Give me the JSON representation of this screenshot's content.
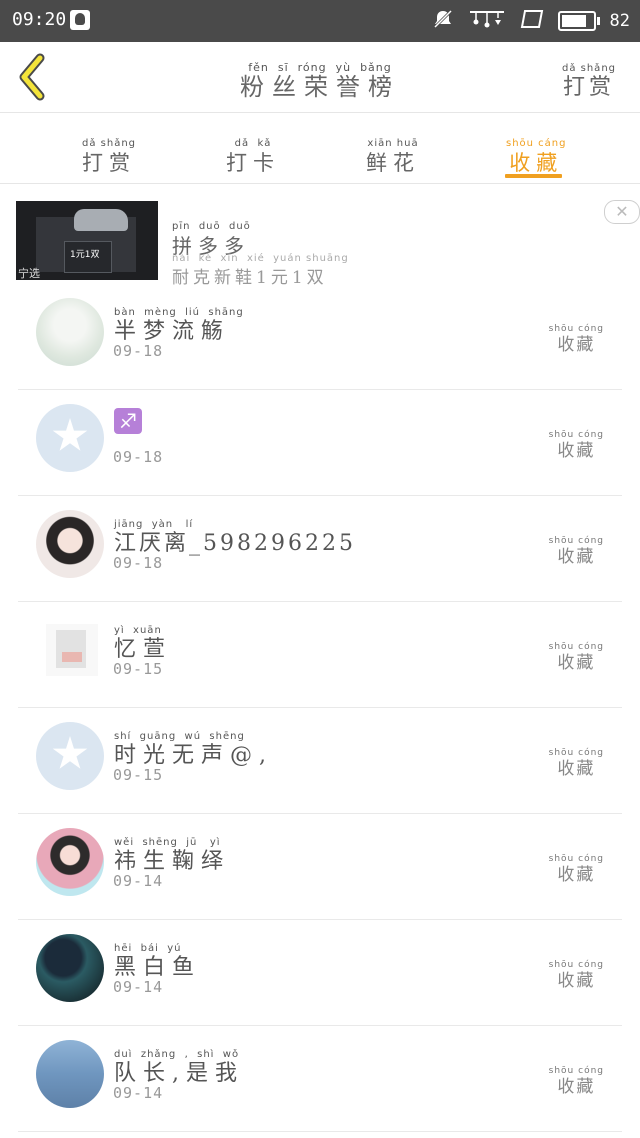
{
  "status_bar": {
    "time": "09:20",
    "battery": "82",
    "icons": [
      "qq-icon",
      "mute-icon",
      "chime-icon",
      "screen-icon",
      "battery-icon"
    ]
  },
  "header": {
    "title_pinyin": "fěn  sī  róng  yù  bǎng",
    "title": "粉丝荣誉榜",
    "reward_pinyin": "dǎ shǎng",
    "reward": "打赏",
    "accent_color": "#f0a020"
  },
  "tabs": [
    {
      "pinyin": "dǎ shǎng",
      "label": "打赏"
    },
    {
      "pinyin": "dǎ  kǎ",
      "label": "打卡"
    },
    {
      "pinyin": "xiān huā",
      "label": "鲜花"
    },
    {
      "pinyin": "shōu cáng",
      "label": "收藏",
      "active": true
    }
  ],
  "ad": {
    "brand_pinyin": "pīn  duō  duō",
    "brand": "拼多多",
    "desc_pinyin": "nài  kè  xīn  xié  yuán shuāng",
    "desc": "耐克新鞋1元1双",
    "image_tag": "1元1双",
    "image_corner": "宁选",
    "close": "✕"
  },
  "action": {
    "pinyin": "shōu cóng",
    "label": "收藏"
  },
  "items": [
    {
      "pinyin": "bàn  mèng  liú  shāng",
      "name": "半梦流觞",
      "date": "09-18"
    },
    {
      "pinyin": "",
      "name": "",
      "emoji": "♐",
      "date": "09-18"
    },
    {
      "pinyin": "jiāng  yàn   lí",
      "name": "江厌离_598296225",
      "date": "09-18"
    },
    {
      "pinyin": "yì  xuān",
      "name": "忆萱",
      "date": "09-15"
    },
    {
      "pinyin": "shí  guāng  wú  shēng",
      "name": "时光无声@,",
      "date": "09-15"
    },
    {
      "pinyin": "wěi  shēng  jū   yì",
      "name": "祎生鞠绎",
      "date": "09-14"
    },
    {
      "pinyin": "hēi  bái  yú",
      "name": "黑白鱼",
      "date": "09-14"
    },
    {
      "pinyin": "duì  zhǎng  ,  shì  wǒ",
      "name": "队长,是我",
      "date": "09-14"
    }
  ]
}
